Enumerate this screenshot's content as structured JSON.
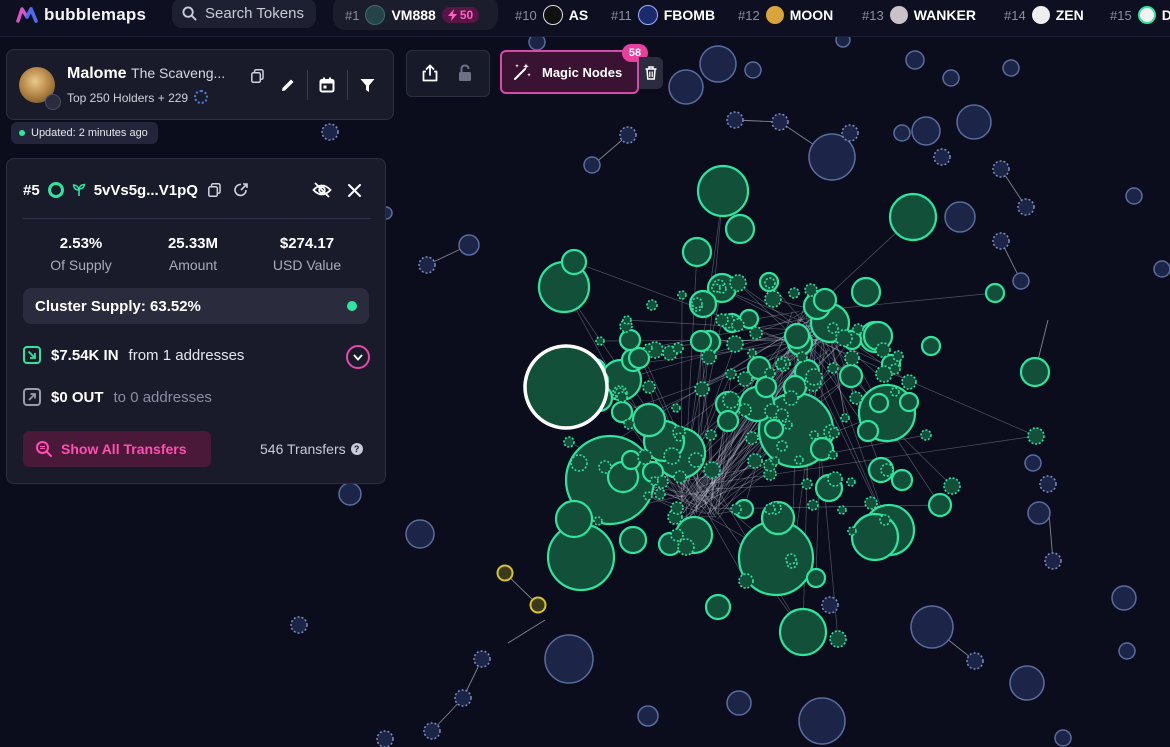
{
  "brand": {
    "name": "bubblemaps"
  },
  "search": {
    "label": "Search Tokens"
  },
  "tickers": [
    {
      "rank": "#1",
      "name": "VM888",
      "boost": "50"
    },
    {
      "rank": "#10",
      "name": "AS"
    },
    {
      "rank": "#11",
      "name": "FBOMB"
    },
    {
      "rank": "#12",
      "name": "MOON"
    },
    {
      "rank": "#13",
      "name": "WANKER"
    },
    {
      "rank": "#14",
      "name": "ZEN"
    },
    {
      "rank": "#15",
      "name": "D"
    }
  ],
  "map": {
    "title": "Malome",
    "subtitle": "The Scaveng...",
    "holders": "Top 250 Holders + 229",
    "updated": "Updated: 2 minutes ago"
  },
  "magic_nodes": {
    "label": "Magic Nodes",
    "count": "58"
  },
  "detail": {
    "rank": "#5",
    "address": "5vVs5g...V1pQ",
    "stats": [
      {
        "value": "2.53%",
        "label": "Of Supply"
      },
      {
        "value": "25.33M",
        "label": "Amount"
      },
      {
        "value": "$274.17",
        "label": "USD Value"
      }
    ],
    "cluster_supply": "Cluster Supply: 63.52%",
    "in_amount": "$7.54K IN",
    "in_detail": "from 1 addresses",
    "out_amount": "$0 OUT",
    "out_detail": "to 0 addresses",
    "show_transfers": "Show All Transfers",
    "transfers_count": "546 Transfers"
  },
  "colors": {
    "accent": "#e8409f",
    "cluster": "#2ee59d",
    "bubble": "#1c2547",
    "selected": "#ffffff",
    "highlight": "#d9c22e"
  }
}
